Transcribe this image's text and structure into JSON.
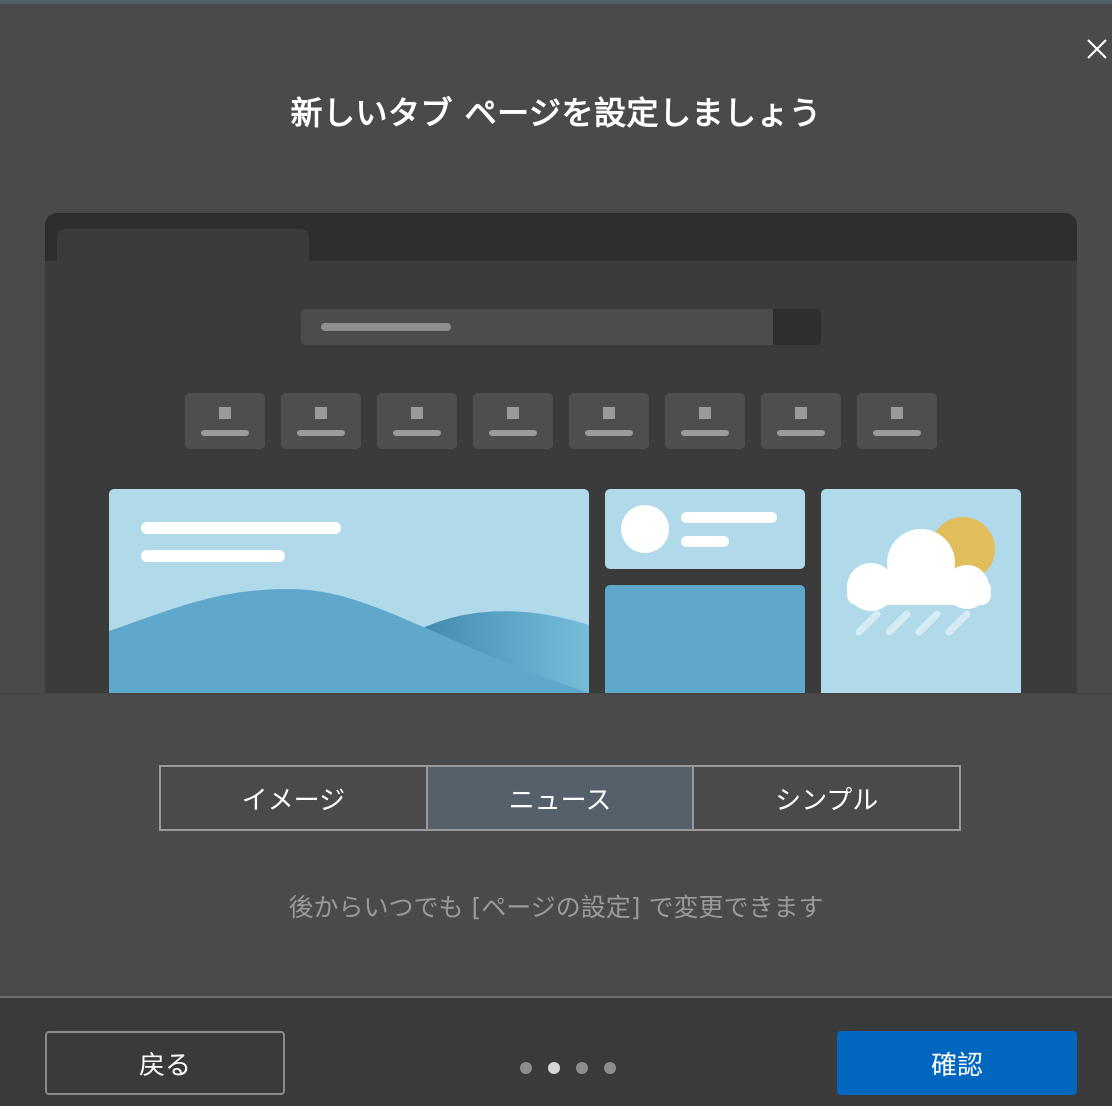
{
  "dialog": {
    "title": "新しいタブ ページを設定しましょう",
    "close_icon": "close-icon"
  },
  "layout_options": {
    "items": [
      {
        "label": "イメージ",
        "selected": false
      },
      {
        "label": "ニュース",
        "selected": true
      },
      {
        "label": "シンプル",
        "selected": false
      }
    ]
  },
  "hint": "後からいつでも [ページの設定] で変更できます",
  "footer": {
    "back_label": "戻る",
    "confirm_label": "確認",
    "steps_total": 4,
    "current_step": 2
  },
  "colors": {
    "accent": "#0067c0",
    "card_light": "#b0d9ea",
    "card_dark": "#5fa8cb",
    "sun": "#e2bd5c"
  }
}
